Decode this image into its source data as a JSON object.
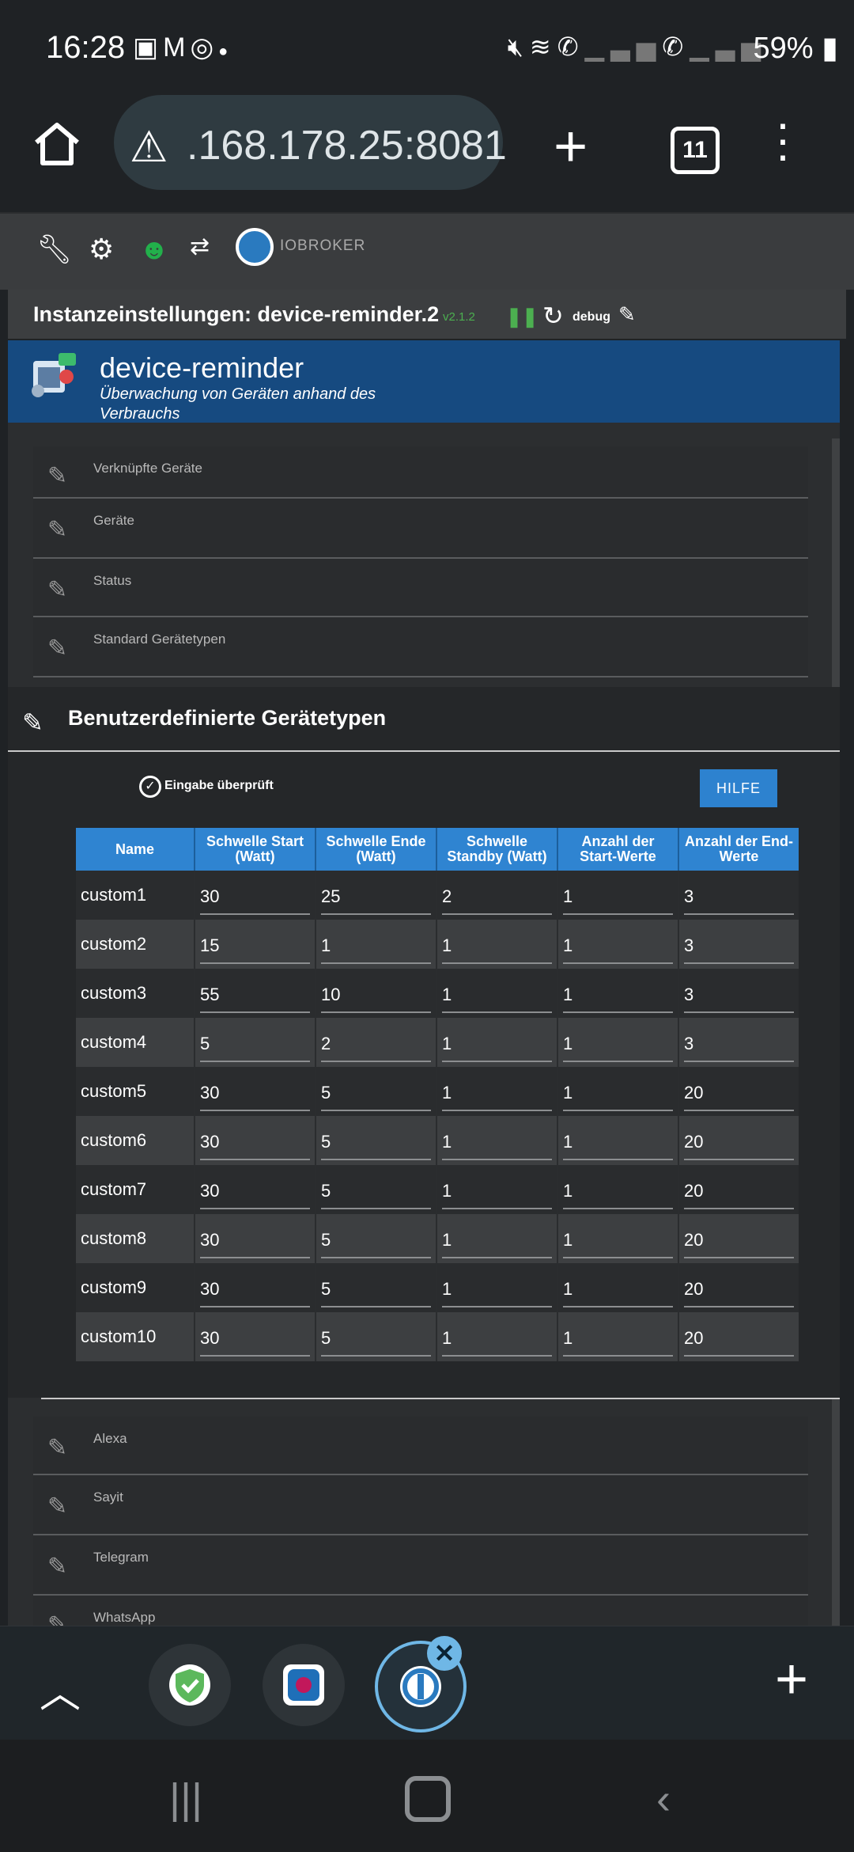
{
  "status_bar": {
    "time": "16:28",
    "battery": "59%",
    "left_icons": [
      "image-icon",
      "gmail-icon",
      "whatsapp-icon",
      "dot-icon"
    ],
    "right_icons": [
      "mute-icon",
      "wifi-icon",
      "call-wifi-1-icon",
      "signal-1-icon",
      "call-wifi-2-icon",
      "signal-2-icon"
    ]
  },
  "browser": {
    "url": ".168.178.25:8081",
    "tab_count": "11"
  },
  "toolbar": {
    "brand": "IOBROKER",
    "icons": [
      "wrench-icon",
      "settings-icon",
      "expert-mode-icon",
      "sync-icon",
      "iobroker-logo-icon"
    ],
    "expert_color": "#22b04b"
  },
  "titlebar": {
    "title": "Instanzeinstellungen: device-reminder.2",
    "version": "v2.1.2",
    "log_level": "debug"
  },
  "adapter": {
    "name": "device-reminder",
    "description": "Überwachung von Geräten anhand des Verbrauchs"
  },
  "sections_top": [
    {
      "label": "Verknüpfte Geräte"
    },
    {
      "label": "Geräte"
    },
    {
      "label": "Status"
    },
    {
      "label": "Standard Gerätetypen"
    }
  ],
  "custom": {
    "header": "Benutzerdefinierte Gerätetypen",
    "checked_label": "Eingabe überprüft",
    "help_button": "HILFE",
    "columns": [
      "Name",
      "Schwelle Start (Watt)",
      "Schwelle Ende (Watt)",
      "Schwelle Standby (Watt)",
      "Anzahl der Start-Werte",
      "Anzahl der End-Werte"
    ],
    "rows": [
      [
        "custom1",
        "30",
        "25",
        "2",
        "1",
        "3"
      ],
      [
        "custom2",
        "15",
        "1",
        "1",
        "1",
        "3"
      ],
      [
        "custom3",
        "55",
        "10",
        "1",
        "1",
        "3"
      ],
      [
        "custom4",
        "5",
        "2",
        "1",
        "1",
        "3"
      ],
      [
        "custom5",
        "30",
        "5",
        "1",
        "1",
        "20"
      ],
      [
        "custom6",
        "30",
        "5",
        "1",
        "1",
        "20"
      ],
      [
        "custom7",
        "30",
        "5",
        "1",
        "1",
        "20"
      ],
      [
        "custom8",
        "30",
        "5",
        "1",
        "1",
        "20"
      ],
      [
        "custom9",
        "30",
        "5",
        "1",
        "1",
        "20"
      ],
      [
        "custom10",
        "30",
        "5",
        "1",
        "1",
        "20"
      ]
    ]
  },
  "sections_bottom": [
    {
      "label": "Alexa"
    },
    {
      "label": "Sayit"
    },
    {
      "label": "Telegram"
    },
    {
      "label": "WhatsApp"
    }
  ],
  "colors": {
    "accent": "#2f84d1",
    "banner": "#164a80",
    "ok": "#4caf50"
  }
}
